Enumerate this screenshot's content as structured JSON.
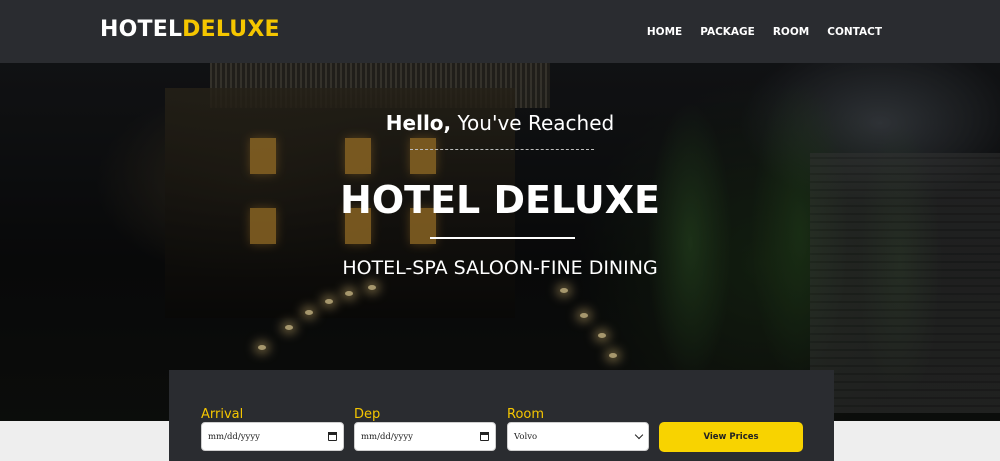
{
  "header": {
    "logo_part1": "HOTEL",
    "logo_part2": "DELUXE",
    "nav": [
      "HOME",
      "PACKAGE",
      "ROOM",
      "CONTACT"
    ]
  },
  "hero": {
    "hello_bold": "Hello,",
    "hello_rest": " You've Reached",
    "title": "HOTEL DELUXE",
    "subtitle": "HOTEL-SPA SALOON-FINE DINING"
  },
  "booking": {
    "arrival_label": "Arrival",
    "arrival_value": "mm/dd/yyyy",
    "dep_label": "Dep",
    "dep_value": "mm/dd/yyyy",
    "room_label": "Room",
    "room_value": "Volvo",
    "button_label": "View Prices"
  },
  "colors": {
    "header_bg": "#2a2c30",
    "accent": "#f5c600",
    "button": "#f8d300"
  }
}
